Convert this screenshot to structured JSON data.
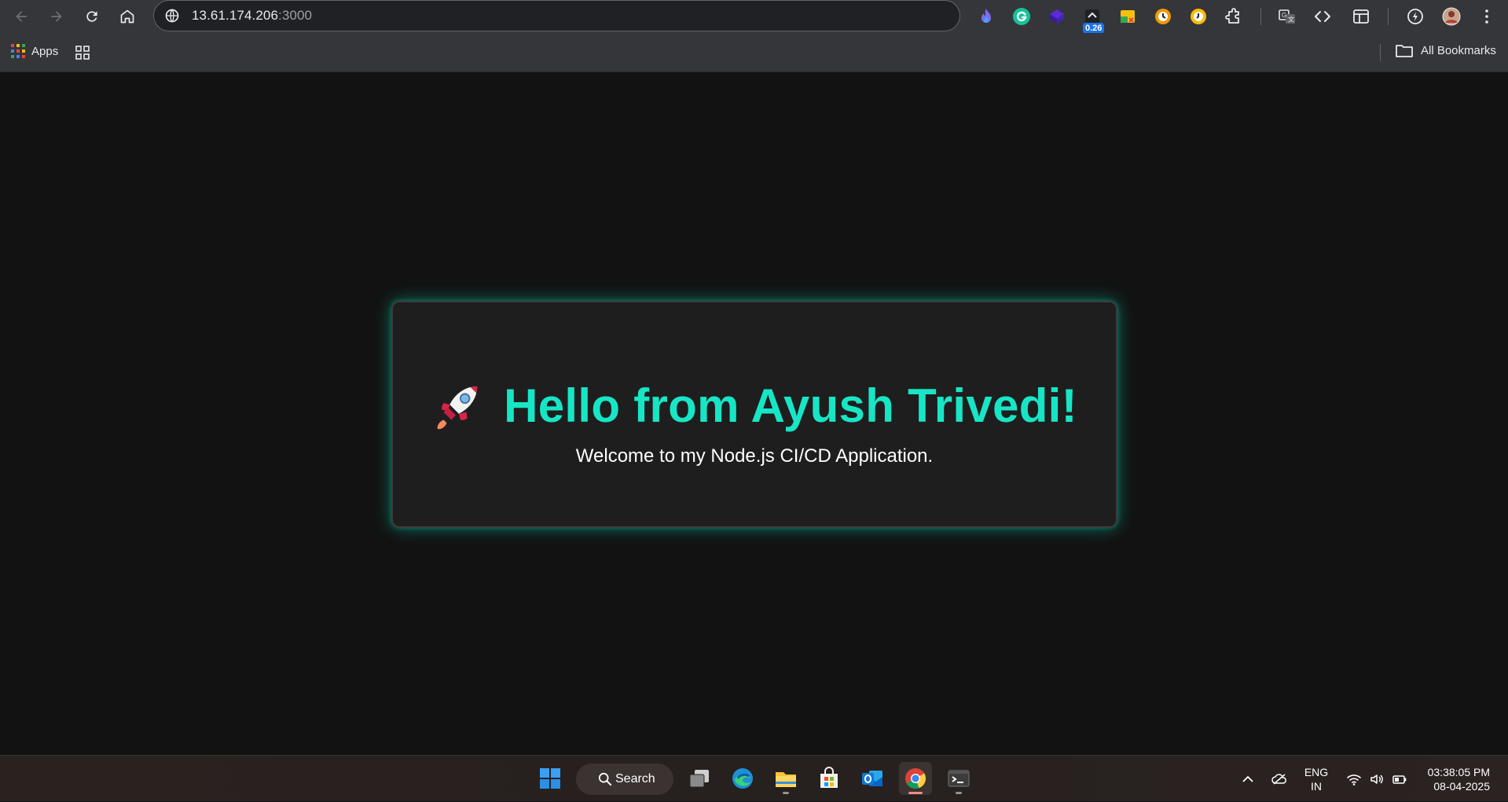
{
  "browser": {
    "url_host": "13.61.174.206",
    "url_port": ":3000",
    "extensions": [
      {
        "name": "flame-extension-icon"
      },
      {
        "name": "grammarly-icon"
      },
      {
        "name": "purple-cube-extension-icon"
      },
      {
        "name": "counter-extension-icon",
        "badge": "0.26"
      },
      {
        "name": "sticky-notes-extension-icon"
      },
      {
        "name": "orange-clock-extension-icon"
      },
      {
        "name": "yellow-timer-extension-icon"
      },
      {
        "name": "extensions-puzzle-icon"
      },
      {
        "name": "translate-icon"
      },
      {
        "name": "code-icon"
      },
      {
        "name": "side-panel-icon"
      },
      {
        "name": "performance-icon"
      },
      {
        "name": "profile-avatar"
      },
      {
        "name": "menu-kebab-icon"
      }
    ]
  },
  "bookmarks": {
    "apps_label": "Apps",
    "all_bookmarks_label": "All Bookmarks"
  },
  "page": {
    "headline": "Hello from Ayush Trivedi!",
    "subtext": "Welcome to my Node.js CI/CD Application.",
    "accent_color": "#17e6c6",
    "background_color": "#121212",
    "card_color": "#1e1e1e"
  },
  "taskbar": {
    "search_label": "Search",
    "lang_line1": "ENG",
    "lang_line2": "IN",
    "time": "03:38:05 PM",
    "date": "08-04-2025",
    "apps": [
      "start",
      "search",
      "task-view",
      "edge",
      "file-explorer",
      "microsoft-store",
      "outlook",
      "chrome",
      "terminal"
    ]
  }
}
